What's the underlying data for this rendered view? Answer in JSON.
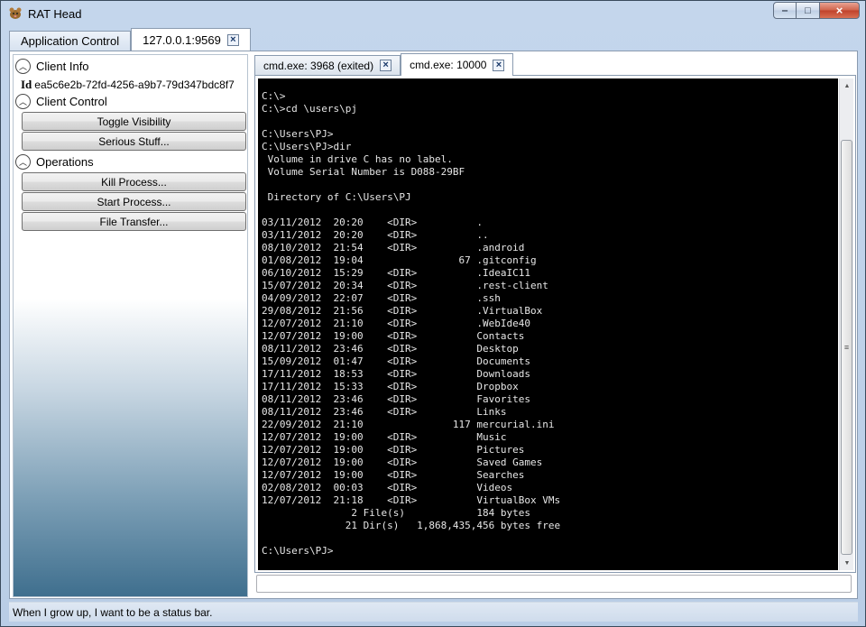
{
  "window": {
    "title": "RAT Head"
  },
  "outer_tabs": [
    {
      "label": "Application Control"
    },
    {
      "label": "127.0.0.1:9569"
    }
  ],
  "left_panel": {
    "client_info": {
      "header": "Client Info",
      "id_label": "Id",
      "id_value": "ea5c6e2b-72fd-4256-a9b7-79d347bdc8f7"
    },
    "client_control": {
      "header": "Client Control",
      "buttons": [
        "Toggle Visibility",
        "Serious Stuff..."
      ]
    },
    "operations": {
      "header": "Operations",
      "buttons": [
        "Kill Process...",
        "Start Process...",
        "File Transfer..."
      ]
    }
  },
  "term_tabs": [
    {
      "label": "cmd.exe: 3968 (exited)"
    },
    {
      "label": "cmd.exe: 10000"
    }
  ],
  "terminal": {
    "output": "C:\\>\nC:\\>cd \\users\\pj\n\nC:\\Users\\PJ>\nC:\\Users\\PJ>dir\n Volume in drive C has no label.\n Volume Serial Number is D088-29BF\n\n Directory of C:\\Users\\PJ\n\n03/11/2012  20:20    <DIR>          .\n03/11/2012  20:20    <DIR>          ..\n08/10/2012  21:54    <DIR>          .android\n01/08/2012  19:04                67 .gitconfig\n06/10/2012  15:29    <DIR>          .IdeaIC11\n15/07/2012  20:34    <DIR>          .rest-client\n04/09/2012  22:07    <DIR>          .ssh\n29/08/2012  21:56    <DIR>          .VirtualBox\n12/07/2012  21:10    <DIR>          .WebIde40\n12/07/2012  19:00    <DIR>          Contacts\n08/11/2012  23:46    <DIR>          Desktop\n15/09/2012  01:47    <DIR>          Documents\n17/11/2012  18:53    <DIR>          Downloads\n17/11/2012  15:33    <DIR>          Dropbox\n08/11/2012  23:46    <DIR>          Favorites\n08/11/2012  23:46    <DIR>          Links\n22/09/2012  21:10               117 mercurial.ini\n12/07/2012  19:00    <DIR>          Music\n12/07/2012  19:00    <DIR>          Pictures\n12/07/2012  19:00    <DIR>          Saved Games\n12/07/2012  19:00    <DIR>          Searches\n02/08/2012  00:03    <DIR>          Videos\n12/07/2012  21:18    <DIR>          VirtualBox VMs\n               2 File(s)            184 bytes\n              21 Dir(s)   1,868,435,456 bytes free\n\nC:\\Users\\PJ>"
  },
  "command_input": {
    "value": ""
  },
  "status_bar": {
    "text": "When I grow up, I want to be a status bar."
  },
  "icons": {
    "close": "×",
    "minimize": "‒",
    "maximize": "□",
    "collapse": "︿"
  }
}
